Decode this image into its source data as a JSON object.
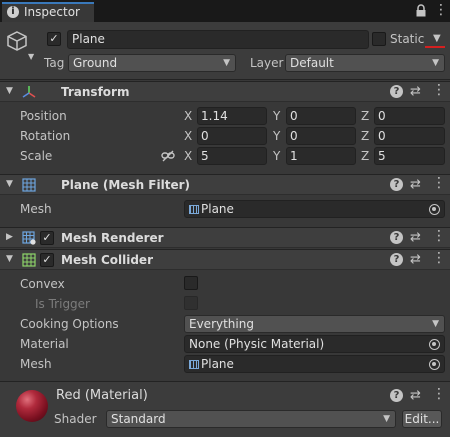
{
  "tab": {
    "title": "Inspector",
    "info_glyph": "i",
    "menu_glyph": "⋮"
  },
  "header": {
    "name": "Plane",
    "static_label": "Static",
    "tag_label": "Tag",
    "tag_value": "Ground",
    "layer_label": "Layer",
    "layer_value": "Default",
    "active_check": "✓"
  },
  "transform": {
    "title": "Transform",
    "rows": [
      {
        "label": "Position",
        "x": "1.14",
        "y": "0",
        "z": "0"
      },
      {
        "label": "Rotation",
        "x": "0",
        "y": "0",
        "z": "0"
      },
      {
        "label": "Scale",
        "x": "5",
        "y": "1",
        "z": "5"
      }
    ],
    "axes": [
      "X",
      "Y",
      "Z"
    ]
  },
  "mesh_filter": {
    "title": "Plane (Mesh Filter)",
    "mesh_label": "Mesh",
    "mesh_value": "Plane"
  },
  "mesh_renderer": {
    "title": "Mesh Renderer",
    "check": "✓"
  },
  "mesh_collider": {
    "title": "Mesh Collider",
    "check": "✓",
    "convex_label": "Convex",
    "trigger_label": "Is Trigger",
    "cooking_label": "Cooking Options",
    "cooking_value": "Everything",
    "material_label": "Material",
    "material_value": "None (Physic Material)",
    "mesh_label": "Mesh",
    "mesh_value": "Plane"
  },
  "material": {
    "title": "Red (Material)",
    "shader_label": "Shader",
    "shader_value": "Standard",
    "edit_label": "Edit..."
  },
  "icons": {
    "help": "?",
    "sliders": "⇄",
    "kebab": "⋮",
    "fold_open": "▼",
    "fold_closed": "▶",
    "drop_arrow": "▼"
  },
  "colors": {
    "accent_tab": "#3a79bb",
    "static_underline": "#d42020",
    "material_red": "#b02a3c"
  }
}
